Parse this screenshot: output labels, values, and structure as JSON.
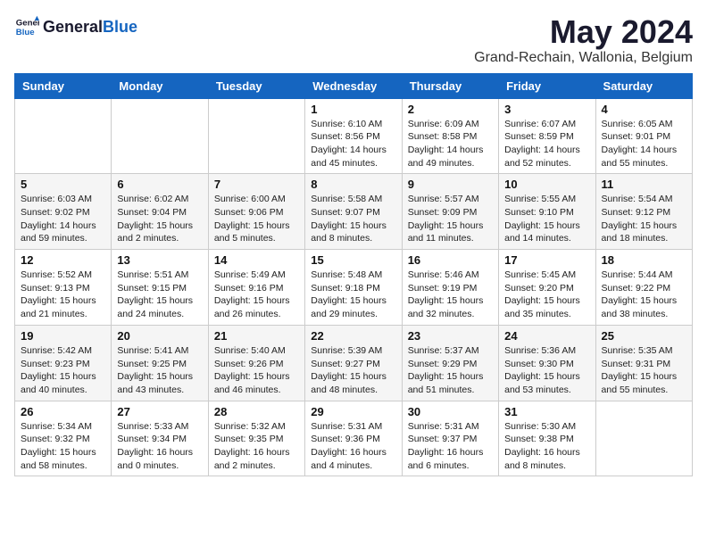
{
  "logo": {
    "general": "General",
    "blue": "Blue"
  },
  "title": "May 2024",
  "location": "Grand-Rechain, Wallonia, Belgium",
  "headers": [
    "Sunday",
    "Monday",
    "Tuesday",
    "Wednesday",
    "Thursday",
    "Friday",
    "Saturday"
  ],
  "weeks": [
    [
      {
        "day": "",
        "info": ""
      },
      {
        "day": "",
        "info": ""
      },
      {
        "day": "",
        "info": ""
      },
      {
        "day": "1",
        "info": "Sunrise: 6:10 AM\nSunset: 8:56 PM\nDaylight: 14 hours and 45 minutes."
      },
      {
        "day": "2",
        "info": "Sunrise: 6:09 AM\nSunset: 8:58 PM\nDaylight: 14 hours and 49 minutes."
      },
      {
        "day": "3",
        "info": "Sunrise: 6:07 AM\nSunset: 8:59 PM\nDaylight: 14 hours and 52 minutes."
      },
      {
        "day": "4",
        "info": "Sunrise: 6:05 AM\nSunset: 9:01 PM\nDaylight: 14 hours and 55 minutes."
      }
    ],
    [
      {
        "day": "5",
        "info": "Sunrise: 6:03 AM\nSunset: 9:02 PM\nDaylight: 14 hours and 59 minutes."
      },
      {
        "day": "6",
        "info": "Sunrise: 6:02 AM\nSunset: 9:04 PM\nDaylight: 15 hours and 2 minutes."
      },
      {
        "day": "7",
        "info": "Sunrise: 6:00 AM\nSunset: 9:06 PM\nDaylight: 15 hours and 5 minutes."
      },
      {
        "day": "8",
        "info": "Sunrise: 5:58 AM\nSunset: 9:07 PM\nDaylight: 15 hours and 8 minutes."
      },
      {
        "day": "9",
        "info": "Sunrise: 5:57 AM\nSunset: 9:09 PM\nDaylight: 15 hours and 11 minutes."
      },
      {
        "day": "10",
        "info": "Sunrise: 5:55 AM\nSunset: 9:10 PM\nDaylight: 15 hours and 14 minutes."
      },
      {
        "day": "11",
        "info": "Sunrise: 5:54 AM\nSunset: 9:12 PM\nDaylight: 15 hours and 18 minutes."
      }
    ],
    [
      {
        "day": "12",
        "info": "Sunrise: 5:52 AM\nSunset: 9:13 PM\nDaylight: 15 hours and 21 minutes."
      },
      {
        "day": "13",
        "info": "Sunrise: 5:51 AM\nSunset: 9:15 PM\nDaylight: 15 hours and 24 minutes."
      },
      {
        "day": "14",
        "info": "Sunrise: 5:49 AM\nSunset: 9:16 PM\nDaylight: 15 hours and 26 minutes."
      },
      {
        "day": "15",
        "info": "Sunrise: 5:48 AM\nSunset: 9:18 PM\nDaylight: 15 hours and 29 minutes."
      },
      {
        "day": "16",
        "info": "Sunrise: 5:46 AM\nSunset: 9:19 PM\nDaylight: 15 hours and 32 minutes."
      },
      {
        "day": "17",
        "info": "Sunrise: 5:45 AM\nSunset: 9:20 PM\nDaylight: 15 hours and 35 minutes."
      },
      {
        "day": "18",
        "info": "Sunrise: 5:44 AM\nSunset: 9:22 PM\nDaylight: 15 hours and 38 minutes."
      }
    ],
    [
      {
        "day": "19",
        "info": "Sunrise: 5:42 AM\nSunset: 9:23 PM\nDaylight: 15 hours and 40 minutes."
      },
      {
        "day": "20",
        "info": "Sunrise: 5:41 AM\nSunset: 9:25 PM\nDaylight: 15 hours and 43 minutes."
      },
      {
        "day": "21",
        "info": "Sunrise: 5:40 AM\nSunset: 9:26 PM\nDaylight: 15 hours and 46 minutes."
      },
      {
        "day": "22",
        "info": "Sunrise: 5:39 AM\nSunset: 9:27 PM\nDaylight: 15 hours and 48 minutes."
      },
      {
        "day": "23",
        "info": "Sunrise: 5:37 AM\nSunset: 9:29 PM\nDaylight: 15 hours and 51 minutes."
      },
      {
        "day": "24",
        "info": "Sunrise: 5:36 AM\nSunset: 9:30 PM\nDaylight: 15 hours and 53 minutes."
      },
      {
        "day": "25",
        "info": "Sunrise: 5:35 AM\nSunset: 9:31 PM\nDaylight: 15 hours and 55 minutes."
      }
    ],
    [
      {
        "day": "26",
        "info": "Sunrise: 5:34 AM\nSunset: 9:32 PM\nDaylight: 15 hours and 58 minutes."
      },
      {
        "day": "27",
        "info": "Sunrise: 5:33 AM\nSunset: 9:34 PM\nDaylight: 16 hours and 0 minutes."
      },
      {
        "day": "28",
        "info": "Sunrise: 5:32 AM\nSunset: 9:35 PM\nDaylight: 16 hours and 2 minutes."
      },
      {
        "day": "29",
        "info": "Sunrise: 5:31 AM\nSunset: 9:36 PM\nDaylight: 16 hours and 4 minutes."
      },
      {
        "day": "30",
        "info": "Sunrise: 5:31 AM\nSunset: 9:37 PM\nDaylight: 16 hours and 6 minutes."
      },
      {
        "day": "31",
        "info": "Sunrise: 5:30 AM\nSunset: 9:38 PM\nDaylight: 16 hours and 8 minutes."
      },
      {
        "day": "",
        "info": ""
      }
    ]
  ]
}
